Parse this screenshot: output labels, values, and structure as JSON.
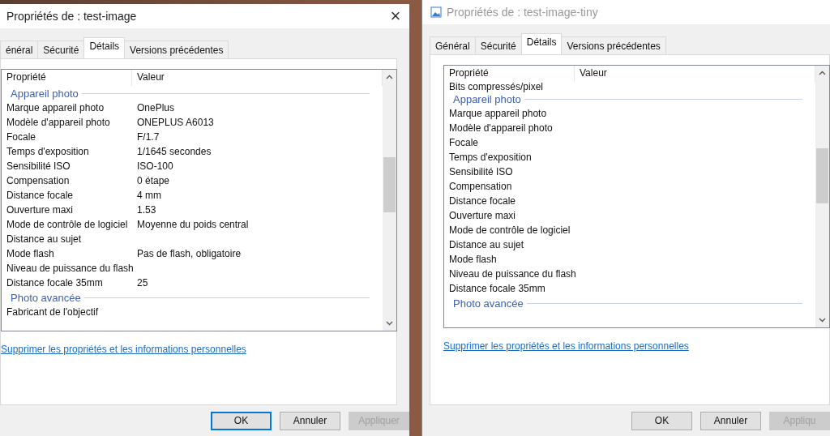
{
  "windows": [
    {
      "title": "Propriétés de : test-image",
      "icon": false,
      "close": "×",
      "tabs": [
        {
          "label": "énéral",
          "selected": false
        },
        {
          "label": "Sécurité",
          "selected": false
        },
        {
          "label": "Détails",
          "selected": true
        },
        {
          "label": "Versions précédentes",
          "selected": false
        }
      ],
      "columns": [
        "Propriété",
        "Valeur"
      ],
      "rows": [
        {
          "kind": "group",
          "label": "Appareil photo"
        },
        {
          "kind": "property",
          "name": "Marque appareil photo",
          "value": "OnePlus"
        },
        {
          "kind": "property",
          "name": "Modèle d'appareil photo",
          "value": "ONEPLUS A6013"
        },
        {
          "kind": "property",
          "name": "Focale",
          "value": "F/1.7"
        },
        {
          "kind": "property",
          "name": "Temps d'exposition",
          "value": "1/1645 secondes"
        },
        {
          "kind": "property",
          "name": "Sensibilité ISO",
          "value": "ISO-100"
        },
        {
          "kind": "property",
          "name": "Compensation",
          "value": "0 étape"
        },
        {
          "kind": "property",
          "name": "Distance focale",
          "value": "4 mm"
        },
        {
          "kind": "property",
          "name": "Ouverture maxi",
          "value": "1.53"
        },
        {
          "kind": "property",
          "name": "Mode de contrôle de logiciel",
          "value": "Moyenne du poids central"
        },
        {
          "kind": "property",
          "name": "Distance au sujet"
        },
        {
          "kind": "property",
          "name": "Mode flash",
          "value": "Pas de flash, obligatoire"
        },
        {
          "kind": "property",
          "name": "Niveau de puissance du flash"
        },
        {
          "kind": "property",
          "name": "Distance focale 35mm",
          "value": "25"
        },
        {
          "kind": "group",
          "label": "Photo avancée"
        },
        {
          "kind": "property",
          "name": "Fabricant de l'objectif"
        }
      ],
      "link": "Supprimer les propriétés et les informations personnelles",
      "buttons": [
        {
          "label": "OK",
          "default": true,
          "disabled": false
        },
        {
          "label": "Annuler",
          "default": false,
          "disabled": false
        },
        {
          "label": "Appliquer",
          "default": false,
          "disabled": true
        }
      ]
    },
    {
      "title": "Propriétés de : test-image-tiny",
      "icon": true,
      "tabs": [
        {
          "label": "Général",
          "selected": false
        },
        {
          "label": "Sécurité",
          "selected": false
        },
        {
          "label": "Détails",
          "selected": true
        },
        {
          "label": "Versions précédentes",
          "selected": false
        }
      ],
      "columns": [
        "Propriété",
        "Valeur"
      ],
      "rows": [
        {
          "kind": "property",
          "name": "Bits compressés/pixel"
        },
        {
          "kind": "group",
          "label": "Appareil photo"
        },
        {
          "kind": "property",
          "name": "Marque appareil photo"
        },
        {
          "kind": "property",
          "name": "Modèle d'appareil photo"
        },
        {
          "kind": "property",
          "name": "Focale"
        },
        {
          "kind": "property",
          "name": "Temps d'exposition"
        },
        {
          "kind": "property",
          "name": "Sensibilité ISO"
        },
        {
          "kind": "property",
          "name": "Compensation"
        },
        {
          "kind": "property",
          "name": "Distance focale"
        },
        {
          "kind": "property",
          "name": "Ouverture maxi"
        },
        {
          "kind": "property",
          "name": "Mode de contrôle de logiciel"
        },
        {
          "kind": "property",
          "name": "Distance au sujet"
        },
        {
          "kind": "property",
          "name": "Mode flash"
        },
        {
          "kind": "property",
          "name": "Niveau de puissance du flash"
        },
        {
          "kind": "property",
          "name": "Distance focale 35mm"
        },
        {
          "kind": "group",
          "label": "Photo avancée"
        }
      ],
      "link": "Supprimer les propriétés et les informations personnelles",
      "buttons": [
        {
          "label": "OK",
          "default": false,
          "disabled": false
        },
        {
          "label": "Annuler",
          "default": false,
          "disabled": false
        },
        {
          "label": "Appliqu",
          "default": false,
          "disabled": true
        }
      ]
    }
  ]
}
